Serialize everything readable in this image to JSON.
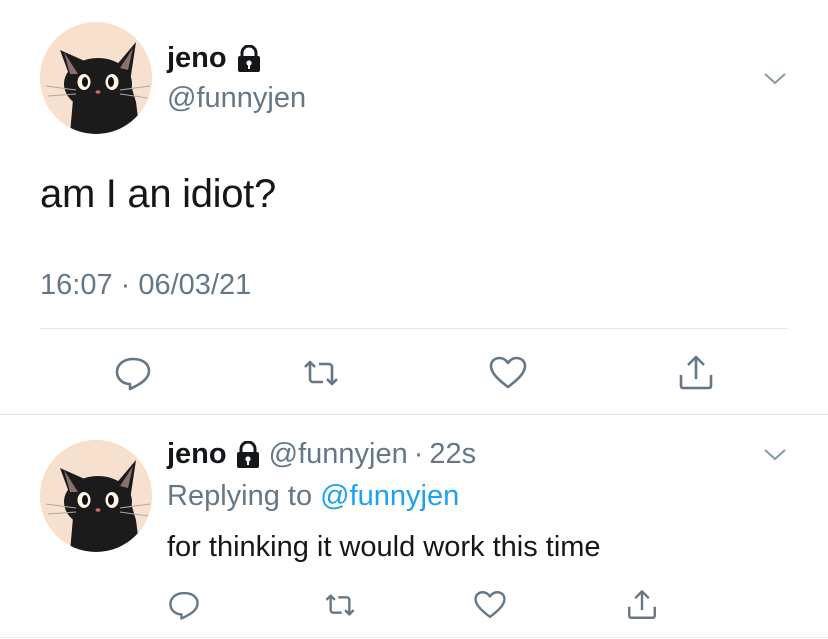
{
  "tweet": {
    "author_name": "jeno",
    "author_handle": "@funnyjen",
    "text": "am I an idiot?",
    "meta": "16:07 · 06/03/21",
    "icons": {
      "lock": "lock-icon",
      "menu": "chevron-down-icon",
      "reply": "reply-icon",
      "retweet": "retweet-icon",
      "like": "heart-icon",
      "share": "share-icon"
    }
  },
  "reply": {
    "author_name": "jeno",
    "author_handle": "@funnyjen",
    "separator": "·",
    "time": "22s",
    "replying_label": "Replying to",
    "replying_handle": "@funnyjen",
    "text": "for thinking it would work this time"
  },
  "colors": {
    "text_primary": "#14171a",
    "text_secondary": "#657786",
    "link": "#1da1f2",
    "avatar_bg": "#f8e0cf",
    "icon": "#657786"
  }
}
